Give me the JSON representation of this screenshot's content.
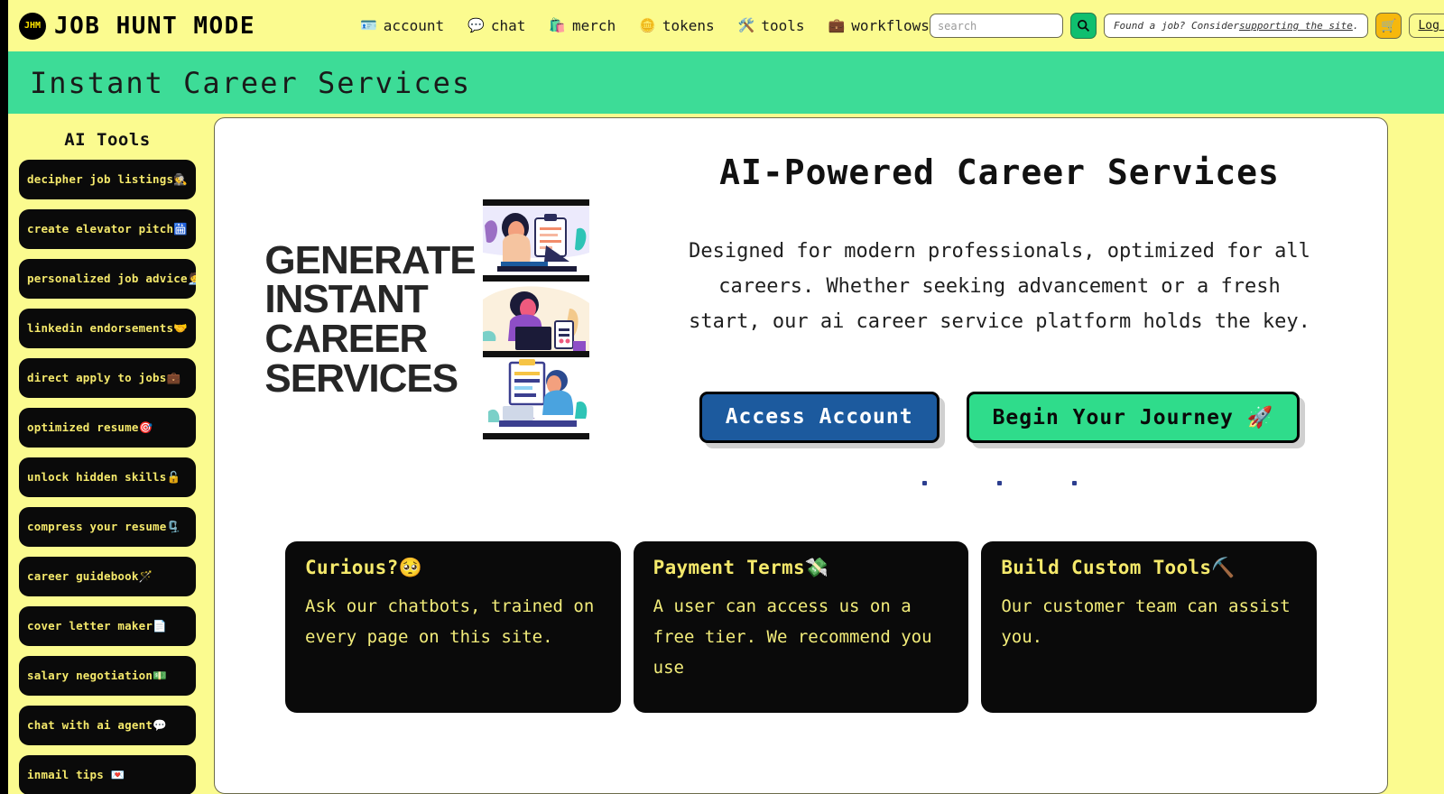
{
  "brand": {
    "logo_text": "JHM",
    "logo_icon": "circle-monogram-icon",
    "name": "JOB HUNT MODE"
  },
  "nav": {
    "items": [
      {
        "label": "account",
        "icon": "🪪",
        "icon_name": "id-card-icon"
      },
      {
        "label": "chat",
        "icon": "💬",
        "icon_name": "speech-balloon-icon"
      },
      {
        "label": "merch",
        "icon": "🛍️",
        "icon_name": "shopping-bag-icon"
      },
      {
        "label": "tokens",
        "icon": "🪙",
        "icon_name": "coin-icon"
      },
      {
        "label": "tools",
        "icon": "🛠️",
        "icon_name": "hammer-and-wrench-icon"
      },
      {
        "label": "workflows",
        "icon": "💼",
        "icon_name": "briefcase-icon"
      }
    ]
  },
  "search": {
    "placeholder": "search",
    "value": "",
    "button_icon": "search-icon"
  },
  "support_banner": {
    "prefix": "Found a job? Consider ",
    "link": "supporting the site",
    "suffix": "."
  },
  "cart": {
    "icon": "🛒",
    "icon_name": "shopping-cart-icon"
  },
  "login": {
    "label": "Log in"
  },
  "subheader": {
    "title": "Instant Career Services"
  },
  "sidebar": {
    "title": "AI Tools",
    "items": [
      {
        "label": "decipher job listings🕵️"
      },
      {
        "label": "create elevator pitch🛗"
      },
      {
        "label": "personalized job advice🧑‍💼"
      },
      {
        "label": "linkedin endorsements🤝"
      },
      {
        "label": "direct apply to jobs💼"
      },
      {
        "label": "optimized resume🎯"
      },
      {
        "label": "unlock hidden skills🔓"
      },
      {
        "label": "compress your resume🗜️"
      },
      {
        "label": "career guidebook🪄"
      },
      {
        "label": "cover letter maker📄"
      },
      {
        "label": "salary negotiation💵"
      },
      {
        "label": "chat with ai agent💬"
      },
      {
        "label": "inmail tips 💌"
      }
    ]
  },
  "hero": {
    "art_words": [
      "GENERATE",
      "INSTANT",
      "CAREER",
      "SERVICES"
    ],
    "art_alt": "three-panel illustration of people working at laptops",
    "title": "AI-Powered Career Services",
    "description": "Designed for modern professionals, optimized for all careers. Whether seeking advancement or a fresh start, our ai career service platform holds the key.",
    "cta_primary": "Access Account",
    "cta_secondary": "Begin Your Journey 🚀",
    "carousel_dots": 3
  },
  "cards": [
    {
      "heading": "Curious?🥺",
      "body": "Ask our chatbots, trained on every page on this site."
    },
    {
      "heading": "Payment Terms💸",
      "body": "A user can access us on a free tier. We recommend you use"
    },
    {
      "heading": "Build Custom Tools⛏️",
      "body": "Our customer team can assist you."
    }
  ],
  "colors": {
    "page_yellow": "#fbfb8f",
    "banner_green": "#3ddc97",
    "accent_green": "#2fdc8b",
    "accent_blue": "#1c5a9e",
    "cart_orange": "#f6b80d",
    "card_black": "#0a0a0a",
    "card_text_yellow": "#f2ec7a"
  }
}
